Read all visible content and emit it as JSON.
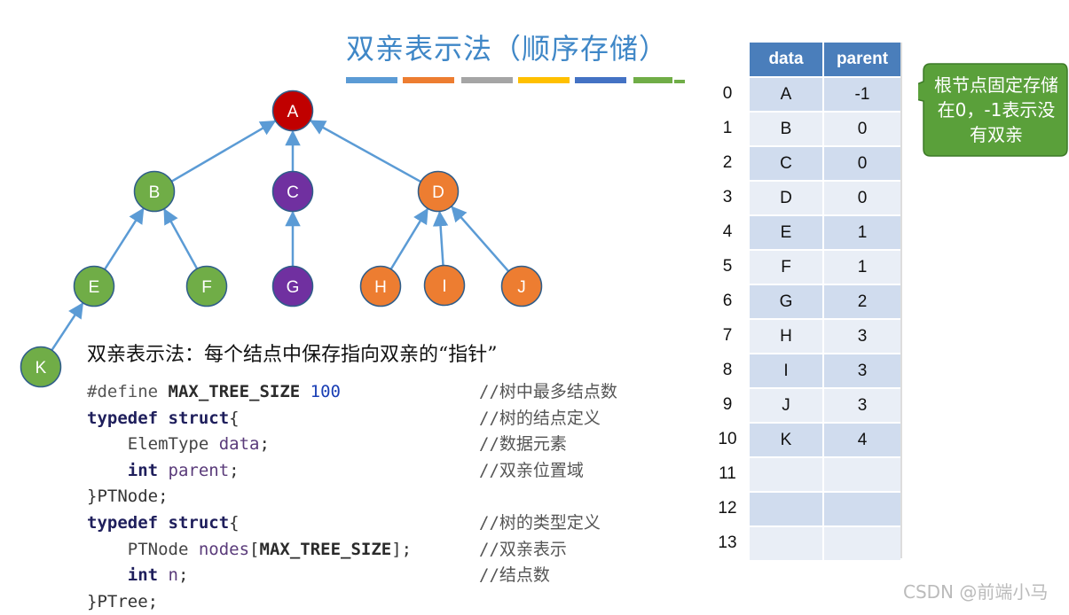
{
  "title": "双亲表示法（顺序存储）",
  "title_bar_colors": [
    "#5b9bd5",
    "#ed7d31",
    "#a5a5a5",
    "#ffc000",
    "#4472c4",
    "#70ad47"
  ],
  "tree": {
    "nodes": [
      {
        "label": "A",
        "color": "#c00000"
      },
      {
        "label": "B",
        "color": "#70ad47"
      },
      {
        "label": "C",
        "color": "#7030a0"
      },
      {
        "label": "D",
        "color": "#ed7d31"
      },
      {
        "label": "E",
        "color": "#70ad47"
      },
      {
        "label": "F",
        "color": "#70ad47"
      },
      {
        "label": "G",
        "color": "#7030a0"
      },
      {
        "label": "H",
        "color": "#ed7d31"
      },
      {
        "label": "I",
        "color": "#ed7d31"
      },
      {
        "label": "J",
        "color": "#ed7d31"
      },
      {
        "label": "K",
        "color": "#70ad47"
      }
    ],
    "edges": [
      [
        "B",
        "A"
      ],
      [
        "C",
        "A"
      ],
      [
        "D",
        "A"
      ],
      [
        "E",
        "B"
      ],
      [
        "F",
        "B"
      ],
      [
        "G",
        "C"
      ],
      [
        "H",
        "D"
      ],
      [
        "I",
        "D"
      ],
      [
        "J",
        "D"
      ],
      [
        "K",
        "E"
      ]
    ],
    "edge_color": "#5b9bd5"
  },
  "description": "双亲表示法：每个结点中保存指向双亲的“指针”",
  "code": {
    "line1": {
      "pp": "#define ",
      "const": "MAX_TREE_SIZE",
      "num": " 100",
      "comment": "//树中最多结点数"
    },
    "line2": {
      "kw": "typedef struct",
      "rest": "{",
      "comment": "//树的结点定义"
    },
    "line3": {
      "typ": "    ElemType ",
      "id": "data",
      "rest": ";",
      "comment": "//数据元素"
    },
    "line4": {
      "kw": "    int ",
      "id": "parent",
      "rest": ";",
      "comment": "//双亲位置域"
    },
    "line5": {
      "rest": "}PTNode;"
    },
    "line6": {
      "kw": "typedef struct",
      "rest": "{",
      "comment": "//树的类型定义"
    },
    "line7": {
      "typ": "    PTNode ",
      "id": "nodes",
      "rest1": "[",
      "const": "MAX_TREE_SIZE",
      "rest2": "];",
      "comment": "//双亲表示"
    },
    "line8": {
      "kw": "    int ",
      "id": "n",
      "rest": ";",
      "comment": "//结点数"
    },
    "line9": {
      "rest": "}PTree;"
    }
  },
  "table": {
    "header": {
      "col1": "data",
      "col2": "parent"
    },
    "rows": [
      {
        "index": "0",
        "data": "A",
        "parent": "-1"
      },
      {
        "index": "1",
        "data": "B",
        "parent": "0"
      },
      {
        "index": "2",
        "data": "C",
        "parent": "0"
      },
      {
        "index": "3",
        "data": "D",
        "parent": "0"
      },
      {
        "index": "4",
        "data": "E",
        "parent": "1"
      },
      {
        "index": "5",
        "data": "F",
        "parent": "1"
      },
      {
        "index": "6",
        "data": "G",
        "parent": "2"
      },
      {
        "index": "7",
        "data": "H",
        "parent": "3"
      },
      {
        "index": "8",
        "data": "I",
        "parent": "3"
      },
      {
        "index": "9",
        "data": "J",
        "parent": "3"
      },
      {
        "index": "10",
        "data": "K",
        "parent": "4"
      },
      {
        "index": "11",
        "data": "",
        "parent": ""
      },
      {
        "index": "12",
        "data": "",
        "parent": ""
      },
      {
        "index": "13",
        "data": "",
        "parent": ""
      }
    ],
    "header_color": "#4a7ebb"
  },
  "callout": {
    "text": "根节点固定存储在0，-1表示没有双亲",
    "color": "#5aa03a"
  },
  "watermark": "CSDN @前端小马"
}
